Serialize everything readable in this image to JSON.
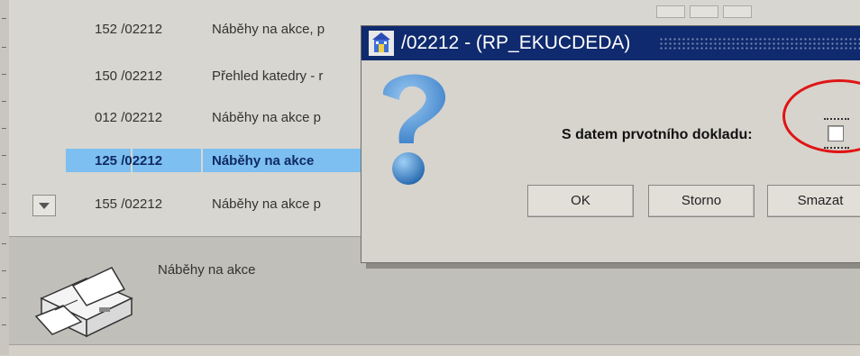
{
  "list": {
    "rows": [
      {
        "num": "152",
        "code": "/02212",
        "desc": "Náběhy na akce, p"
      },
      {
        "num": "150",
        "code": "/02212",
        "desc": "Přehled katedry - r"
      },
      {
        "num": "012",
        "code": "/02212",
        "desc": "Náběhy na akce p"
      },
      {
        "num": "125",
        "code": "/02212",
        "desc": "Náběhy na akce"
      },
      {
        "num": "155",
        "code": "/02212",
        "desc": "Náběhy na akce p"
      }
    ]
  },
  "bottom": {
    "label": "Náběhy na akce"
  },
  "dialog": {
    "title": "/02212 - (RP_EKUCDEDA)",
    "checkbox_label": "S datem prvotního dokladu:",
    "ok_label": "OK",
    "storno_label": "Storno",
    "smazat_label": "Smazat"
  },
  "icons": {
    "app_icon": "oracle-forms-icon",
    "dialog_icon": "question-mark-icon",
    "printer_icon": "printer-icon",
    "dropdown_icon": "chevron-down-icon"
  },
  "colors": {
    "titlebar": "#0f2a6e",
    "selection": "#7dbff0",
    "annotation_circle": "#e01414"
  }
}
